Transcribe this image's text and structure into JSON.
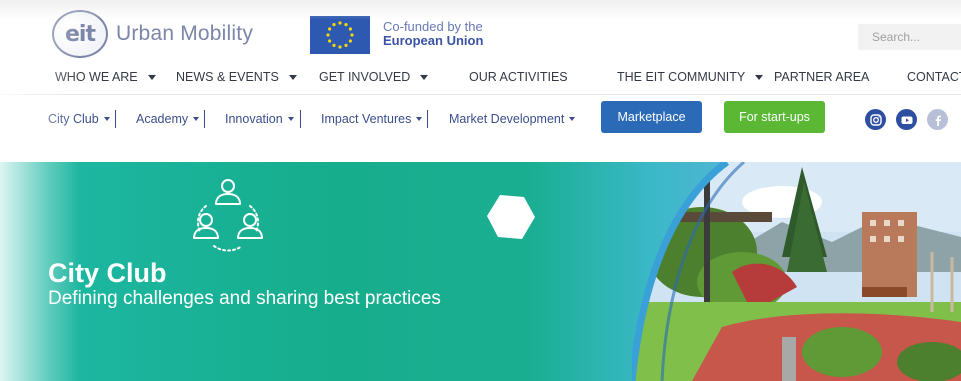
{
  "header": {
    "logo_mark": "eit",
    "logo_text": "Urban Mobility",
    "eu_line1": "Co-funded by the",
    "eu_line2": "European Union",
    "search_placeholder": "Search..."
  },
  "main_nav": {
    "items": [
      {
        "label": "WHO WE ARE",
        "has_dropdown": true
      },
      {
        "label": "NEWS & EVENTS",
        "has_dropdown": true
      },
      {
        "label": "GET INVOLVED",
        "has_dropdown": true
      },
      {
        "label": "OUR ACTIVITIES",
        "has_dropdown": false
      },
      {
        "label": "THE EIT COMMUNITY",
        "has_dropdown": true
      },
      {
        "label": "PARTNER AREA",
        "has_dropdown": false
      },
      {
        "label": "CONTACT",
        "has_dropdown": false
      }
    ]
  },
  "sub_nav": {
    "items": [
      {
        "label": "City Club"
      },
      {
        "label": "Academy"
      },
      {
        "label": "Innovation"
      },
      {
        "label": "Impact Ventures"
      },
      {
        "label": "Market Development"
      }
    ],
    "marketplace_label": "Marketplace",
    "startups_label": "For start-ups",
    "social": [
      "instagram-icon",
      "youtube-icon",
      "facebook-icon"
    ]
  },
  "hero": {
    "title": "City Club",
    "subtitle": "Defining challenges and sharing best practices",
    "icon": "people-network-icon"
  },
  "colors": {
    "brand_blue": "#2a6ab6",
    "brand_green": "#5bb834",
    "hero_teal": "#16ad8c",
    "nav_link": "#3b4e8c"
  }
}
